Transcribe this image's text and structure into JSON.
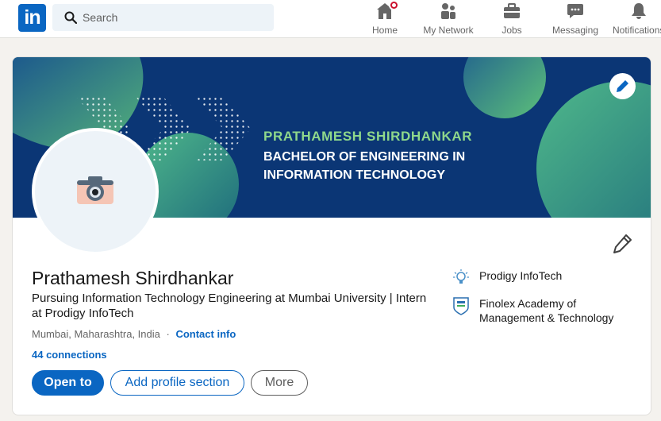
{
  "nav": {
    "search_placeholder": "Search",
    "items": [
      {
        "label": "Home",
        "icon": "home-icon"
      },
      {
        "label": "My Network",
        "icon": "network-icon"
      },
      {
        "label": "Jobs",
        "icon": "briefcase-icon"
      },
      {
        "label": "Messaging",
        "icon": "message-icon"
      },
      {
        "label": "Notifications",
        "icon": "bell-icon"
      }
    ],
    "logo_text": "in"
  },
  "banner": {
    "title": "PRATHAMESH SHIRDHANKAR",
    "line1": "BACHELOR OF ENGINEERING IN",
    "line2": "INFORMATION TECHNOLOGY"
  },
  "profile": {
    "name": "Prathamesh Shirdhankar",
    "headline": "Pursuing Information Technology Engineering at Mumbai University | Intern at Prodigy InfoTech",
    "location": "Mumbai, Maharashtra, India",
    "separator": "·",
    "contact_label": "Contact info",
    "connections": "44 connections"
  },
  "actions": {
    "open_to": "Open to",
    "add_section": "Add profile section",
    "more": "More"
  },
  "organizations": [
    {
      "name": "Prodigy InfoTech"
    },
    {
      "name": "Finolex Academy of Management & Technology"
    }
  ],
  "colors": {
    "brand": "#0a66c2",
    "banner_bg": "#0b3675",
    "banner_accent": "#8fd88b",
    "notification_badge": "#cb112d"
  }
}
